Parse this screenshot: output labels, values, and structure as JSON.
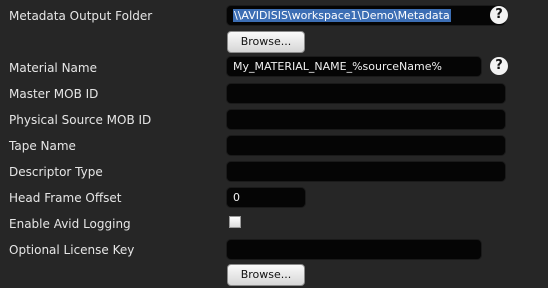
{
  "fields": {
    "metadata_output_folder": {
      "label": "Metadata Output Folder",
      "value": "\\\\AVIDISIS\\workspace1\\Demo\\Metadata"
    },
    "material_name": {
      "label": "Material Name",
      "value": "My_MATERIAL_NAME_%sourceName%"
    },
    "master_mob_id": {
      "label": "Master MOB ID",
      "value": ""
    },
    "physical_source_mob_id": {
      "label": "Physical Source MOB ID",
      "value": ""
    },
    "tape_name": {
      "label": "Tape Name",
      "value": ""
    },
    "descriptor_type": {
      "label": "Descriptor Type",
      "value": ""
    },
    "head_frame_offset": {
      "label": "Head Frame Offset",
      "value": "0"
    },
    "enable_avid_logging": {
      "label": "Enable Avid Logging",
      "checked": false
    },
    "optional_license_key": {
      "label": "Optional License Key",
      "value": ""
    }
  },
  "buttons": {
    "browse_metadata_label": "Browse...",
    "browse_license_label": "Browse..."
  },
  "help": {
    "symbol": "?"
  }
}
